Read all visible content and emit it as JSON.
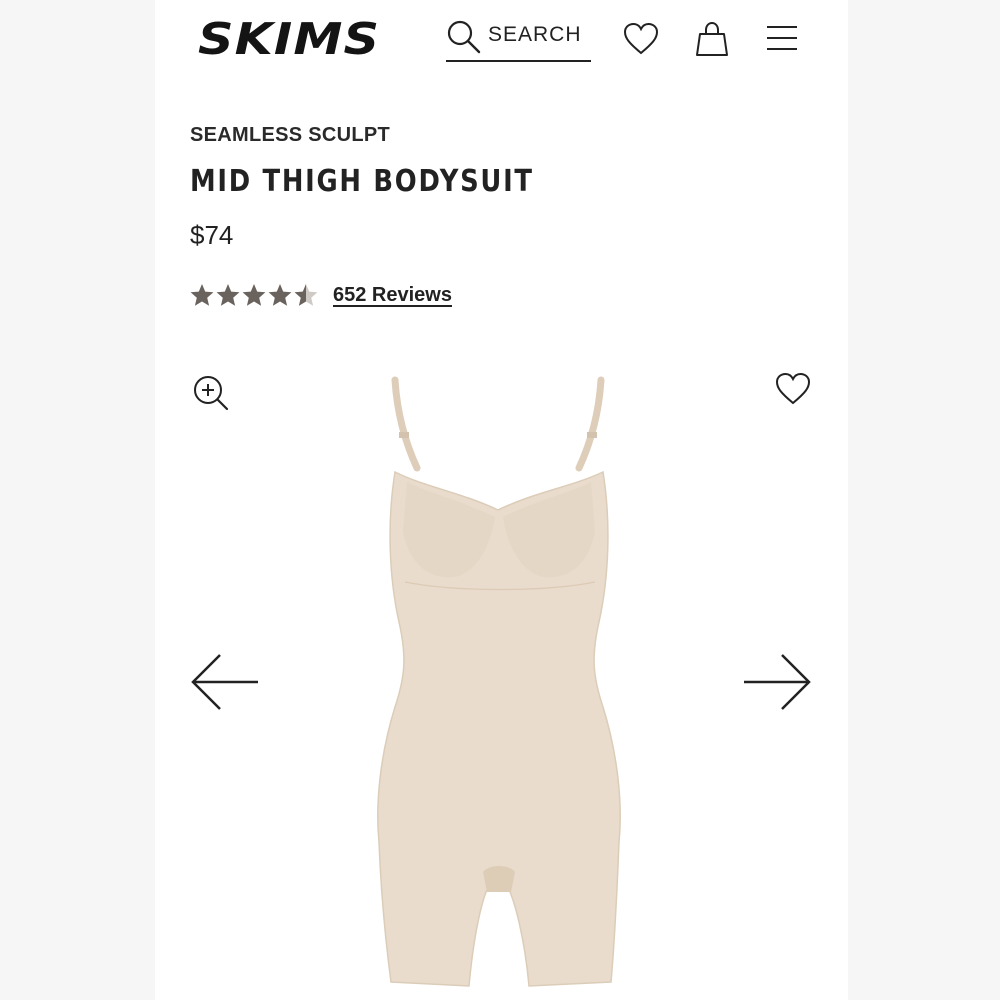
{
  "header": {
    "logo": "SKIMS",
    "search_label": "SEARCH",
    "icons": [
      "search-icon",
      "heart-icon",
      "shopping-bag-icon",
      "menu-icon"
    ]
  },
  "product": {
    "collection": "SEAMLESS SCULPT",
    "name": "MID THIGH BODYSUIT",
    "price": "$74",
    "rating": 4.5,
    "rating_max": 5,
    "reviews_label": "652 Reviews",
    "image_alt_color": "#e9dccd"
  },
  "gallery": {
    "icons": [
      "zoom-in-icon",
      "heart-icon",
      "arrow-left-icon",
      "arrow-right-icon"
    ]
  },
  "colors": {
    "text": "#222222",
    "star": "#6a625c",
    "garment": "#e9dccd"
  }
}
